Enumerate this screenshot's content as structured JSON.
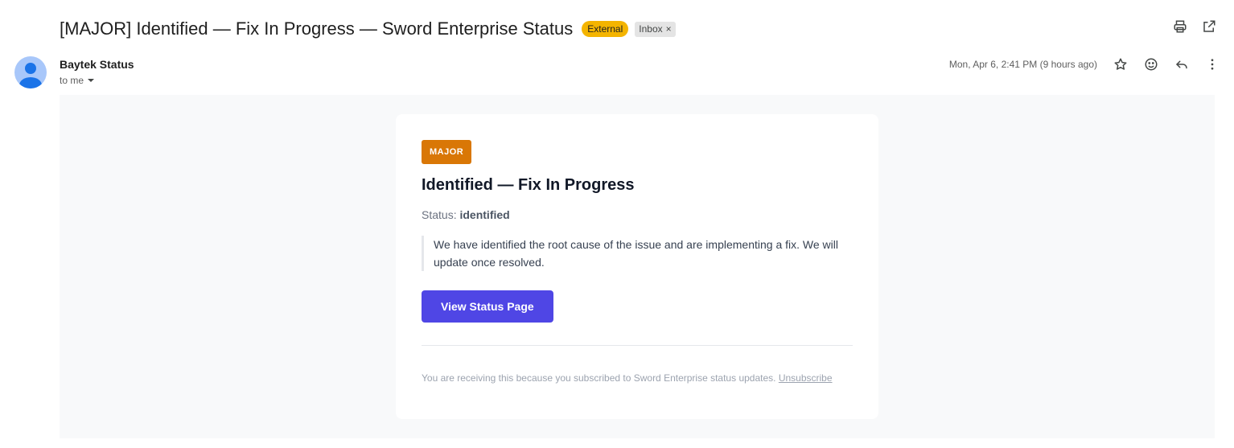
{
  "header": {
    "subject": "[MAJOR] Identified — Fix In Progress — Sword Enterprise Status",
    "labels": {
      "external": "External",
      "inbox": "Inbox",
      "inbox_remove": "×"
    },
    "actions": {
      "print_icon": "print-icon",
      "open_new_window_icon": "open-in-new-icon"
    }
  },
  "sender": {
    "name": "Baytek Status",
    "to_label": "to me",
    "avatar_icon": "person-icon",
    "date": "Mon, Apr 6, 2:41 PM (9 hours ago)"
  },
  "message_actions": [
    "star-icon",
    "emoji-icon",
    "reply-icon",
    "more-icon"
  ],
  "email": {
    "badge": "MAJOR",
    "title": "Identified — Fix In Progress",
    "status_label": "Status:",
    "status_value": "identified",
    "message": "We have identified the root cause of the issue and are implementing a fix. We will update once resolved.",
    "button_label": "View Status Page",
    "footer_text": "You are receiving this because you subscribed to Sword Enterprise status updates.",
    "unsubscribe_label": "Unsubscribe"
  },
  "colors": {
    "external_label": "#f4b400",
    "badge": "#d97706",
    "button": "#4f46e5",
    "avatar": "#a8c7fa",
    "avatar_figure": "#1a73e8"
  }
}
